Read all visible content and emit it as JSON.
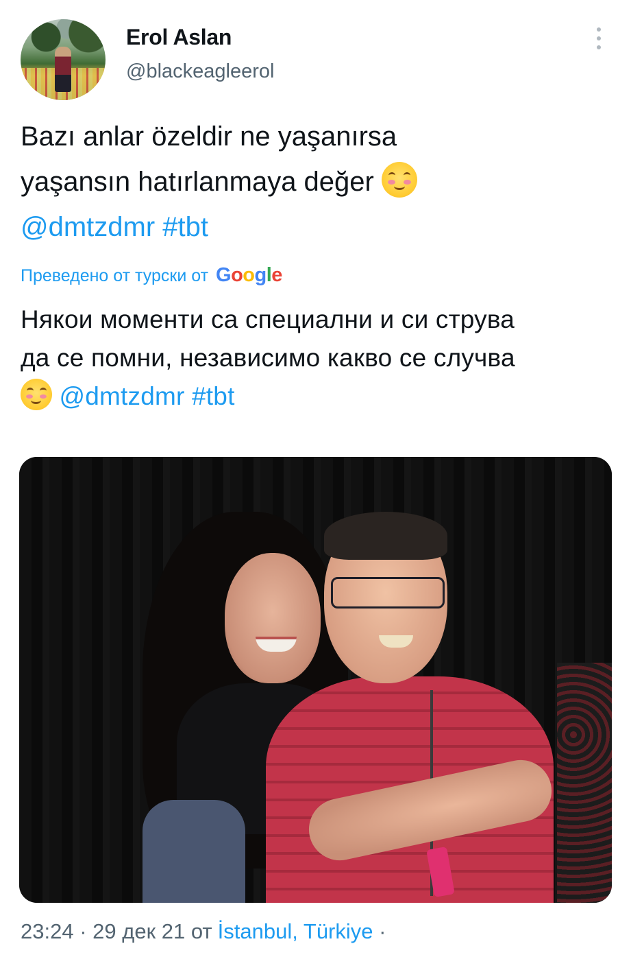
{
  "author": {
    "name": "Erol Aslan",
    "handle": "@blackeagleerol"
  },
  "tweet": {
    "line1": "Bazı anlar özeldir ne yaşanırsa",
    "line2": "yaşansın hatırlanmaya değer",
    "mention": "@dmtzdmr",
    "hashtag": "#tbt",
    "emoji": "smiling-face-with-smiling-eyes"
  },
  "translation": {
    "label": "Преведено от турски от",
    "provider_letters": [
      "G",
      "o",
      "o",
      "g",
      "l",
      "e"
    ],
    "line1": "Някои моменти са специални и си струва",
    "line2": "да се помни, независимо какво се случва",
    "mention": "@dmtzdmr",
    "hashtag": "#tbt"
  },
  "meta": {
    "time": "23:24",
    "separator": "·",
    "date": "29 дек 21",
    "from": "от",
    "location": "İstanbul, Türkiye",
    "trailing": "·"
  },
  "colors": {
    "link": "#1d9bf0",
    "secondary_text": "#536471",
    "primary_text": "#0f1419"
  },
  "icons": {
    "more": "more-vertical-icon"
  }
}
